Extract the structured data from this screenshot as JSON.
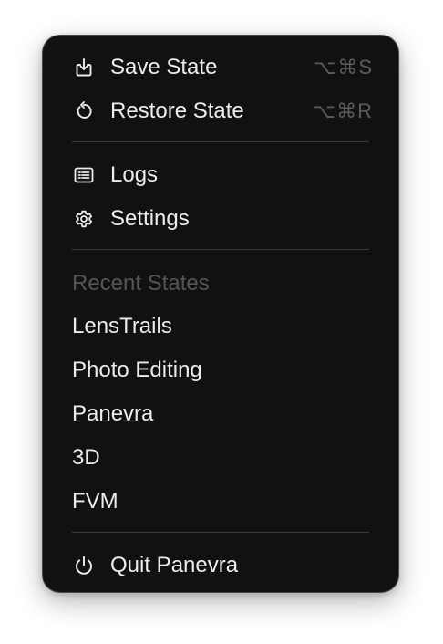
{
  "menu": {
    "actions": [
      {
        "label": "Save State",
        "shortcut": "⌥⌘S",
        "icon": "save-icon"
      },
      {
        "label": "Restore State",
        "shortcut": "⌥⌘R",
        "icon": "restore-icon"
      }
    ],
    "utilities": [
      {
        "label": "Logs",
        "icon": "logs-icon"
      },
      {
        "label": "Settings",
        "icon": "gear-icon"
      }
    ],
    "recent": {
      "title": "Recent States",
      "items": [
        "LensTrails",
        "Photo Editing",
        "Panevra",
        "3D",
        "FVM"
      ]
    },
    "quit": {
      "label": "Quit Panevra",
      "icon": "power-icon"
    }
  },
  "colors": {
    "menu_background": "#111111",
    "text": "#ececec",
    "muted_text": "#555555",
    "shortcut_text": "#5c5c5c",
    "separator": "#3a3a3a"
  }
}
